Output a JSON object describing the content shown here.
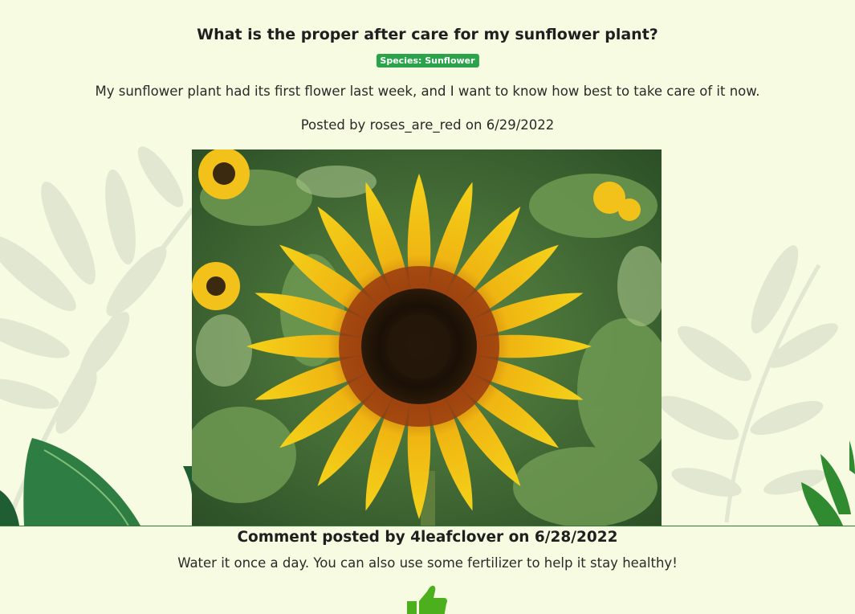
{
  "post": {
    "title": "What is the proper after care for my sunflower plant?",
    "species_badge": "Species: Sunflower",
    "body": "My sunflower plant had its first flower last week, and I want to know how best to take care of it now.",
    "meta": "Posted by roses_are_red on 6/29/2022"
  },
  "comment": {
    "heading": "Comment posted by 4leafclover on 6/28/2022",
    "body": "Water it once a day. You can also use some fertilizer to help it stay healthy!"
  },
  "icons": {
    "like": "thumbs-up-icon"
  },
  "colors": {
    "background": "#f6fbe1",
    "badge": "#2aa34a",
    "like": "#4caf1e",
    "divider": "#2f7a35"
  }
}
